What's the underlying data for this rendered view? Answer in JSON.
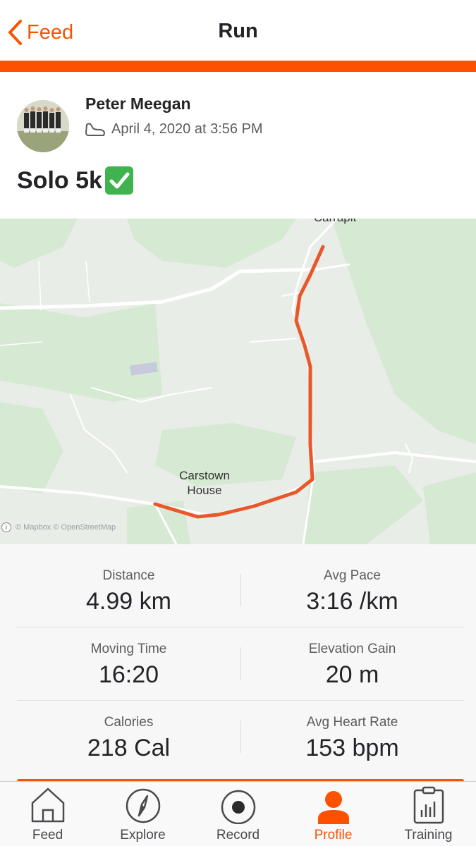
{
  "nav": {
    "back_label": "Feed",
    "title": "Run"
  },
  "activity": {
    "athlete_name": "Peter Meegan",
    "date": "April 4, 2020 at 3:56 PM",
    "sport_icon": "shoe-icon",
    "title": "Solo 5k",
    "title_emoji": "check-mark-button-icon"
  },
  "map": {
    "place_labels": [
      "Carstown\nHouse"
    ],
    "attribution": "© Mapbox © OpenStreetMap",
    "route_color": "#e8582a"
  },
  "stats": {
    "rows": [
      [
        {
          "label": "Distance",
          "value": "4.99 km"
        },
        {
          "label": "Avg Pace",
          "value": "3:16 /km"
        }
      ],
      [
        {
          "label": "Moving Time",
          "value": "16:20"
        },
        {
          "label": "Elevation Gain",
          "value": "20 m"
        }
      ],
      [
        {
          "label": "Calories",
          "value": "218 Cal"
        },
        {
          "label": "Avg Heart Rate",
          "value": "153 bpm"
        }
      ]
    ]
  },
  "tabbar": {
    "items": [
      {
        "label": "Feed",
        "icon": "home-icon",
        "active": false
      },
      {
        "label": "Explore",
        "icon": "compass-icon",
        "active": false
      },
      {
        "label": "Record",
        "icon": "record-icon",
        "active": false
      },
      {
        "label": "Profile",
        "icon": "profile-icon",
        "active": true
      },
      {
        "label": "Training",
        "icon": "clipboard-chart-icon",
        "active": false
      }
    ]
  },
  "colors": {
    "accent": "#fc5200",
    "map_green": "#d6e9d3",
    "map_bg": "#e9ede8"
  }
}
